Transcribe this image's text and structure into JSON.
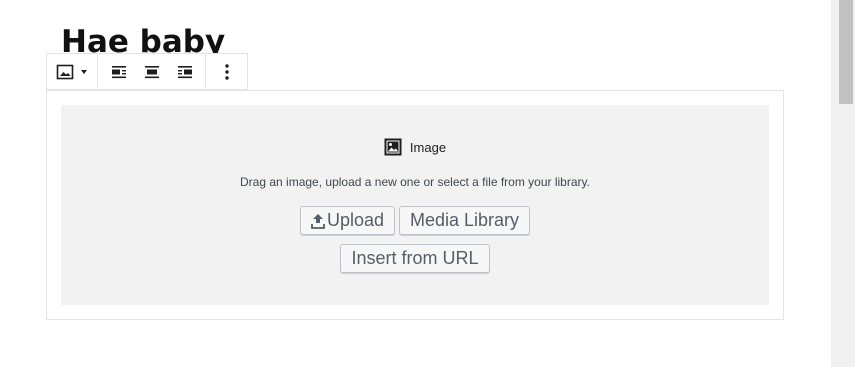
{
  "post": {
    "title": "Hae baby"
  },
  "toolbar": {
    "block_type_icon": "image-icon",
    "dropdown_icon": "caret-down-icon",
    "align_left_icon": "align-left-icon",
    "align_center_icon": "align-center-icon",
    "align_right_icon": "align-right-icon",
    "more_icon": "more-vertical-icon"
  },
  "image_block": {
    "label": "Image",
    "instructions": "Drag an image, upload a new one or select a file from your library.",
    "upload_label": "Upload",
    "media_library_label": "Media Library",
    "insert_url_label": "Insert from URL"
  }
}
